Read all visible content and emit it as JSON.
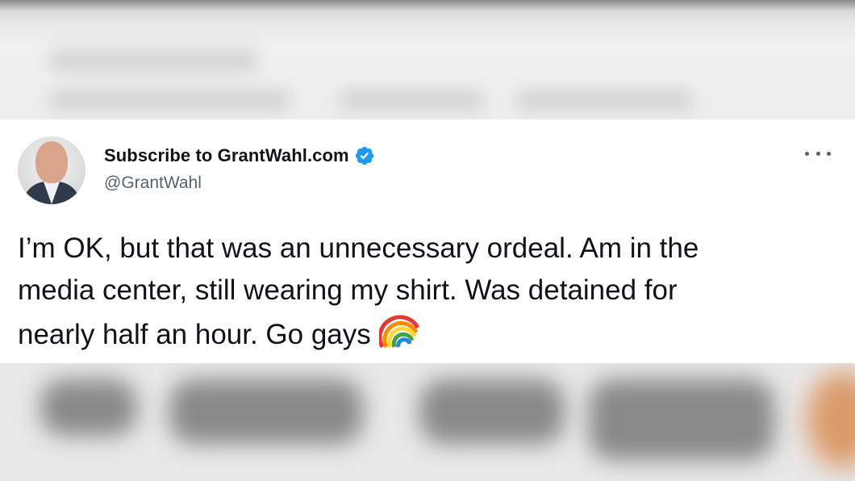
{
  "tweet": {
    "display_name": "Subscribe to GrantWahl.com",
    "handle": "@GrantWahl",
    "verified": true,
    "text_lines": [
      "I’m OK, but that was an unnecessary ordeal. Am in the",
      "media center, still wearing my shirt. Was detained for",
      "nearly half an hour. Go gays"
    ],
    "emoji": "rainbow-icon"
  },
  "icons": {
    "verified": "verified-badge-icon",
    "more": "more-options-icon",
    "rainbow": "rainbow-icon"
  },
  "colors": {
    "text_primary": "#0f1419",
    "text_secondary": "#536471",
    "verified_blue": "#1d9bf0",
    "card_background": "#ffffff"
  }
}
